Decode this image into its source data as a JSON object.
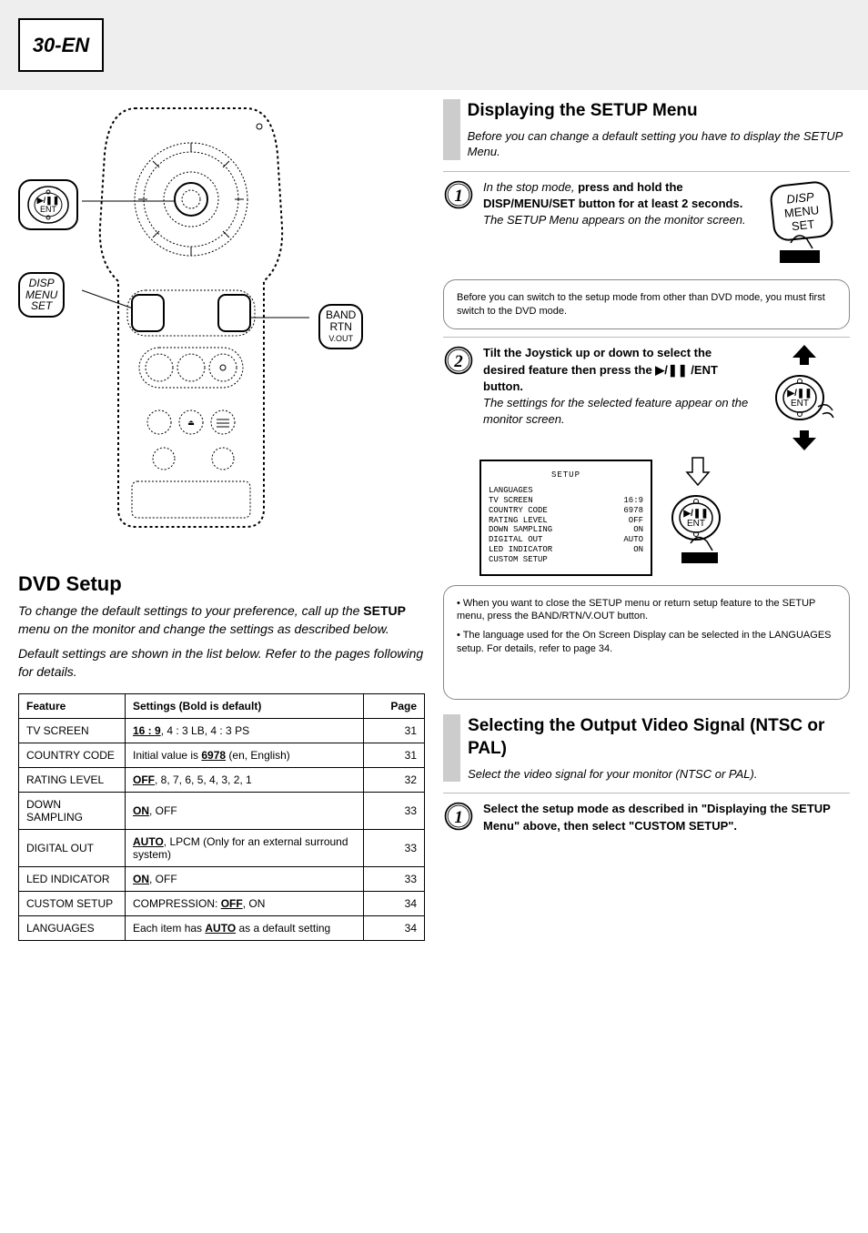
{
  "page_number": "30-EN",
  "callouts": {
    "ent_play_line": "▶/❚❚",
    "ent_label": "ENT",
    "disp": "DISP",
    "menu": "MENU",
    "set": "SET",
    "band": "BAND",
    "rtn": "RTN",
    "vout": "V.OUT"
  },
  "left": {
    "title": "DVD Setup",
    "para1_italic": "To change the default settings to your preference, call up the ",
    "para1_bold": "SETUP",
    "para1_rest": " menu on the monitor and change the settings as described below.",
    "para2": "Default settings are shown in the list below. Refer to the pages following for details.",
    "table": {
      "cols": [
        "Feature",
        "Settings (Bold is default)",
        "Page"
      ],
      "rows": [
        {
          "feature": "TV SCREEN",
          "desc": "<b><u>16 : 9</u></b>, 4 : 3 LB, 4 : 3 PS",
          "page": "31"
        },
        {
          "feature": "COUNTRY CODE",
          "desc": "Initial value is <b><u>6978</u></b> (en, English)",
          "page": "31"
        },
        {
          "feature": "RATING LEVEL",
          "desc": "<b><u>OFF</u></b>, 8, 7, 6, 5, 4, 3, 2, 1",
          "page": "32"
        },
        {
          "feature": "DOWN SAMPLING",
          "desc": "<b><u>ON</u></b>, OFF",
          "page": "33"
        },
        {
          "feature": "DIGITAL OUT",
          "desc": "<b><u>AUTO</u></b>, LPCM (Only for an external surround system)",
          "page": "33"
        },
        {
          "feature": "LED INDICATOR",
          "desc": "<b><u>ON</u></b>, OFF",
          "page": "33"
        },
        {
          "feature": "CUSTOM SETUP",
          "desc": "COMPRESSION: <b><u>OFF</u></b>, ON",
          "page": "34"
        },
        {
          "feature": "LANGUAGES",
          "desc": "Each item has <b><u>AUTO</u></b> as a default setting",
          "page": "34"
        }
      ]
    }
  },
  "right": {
    "sectionA": {
      "heading": "Displaying the SETUP Menu",
      "body": "Before you can change a default setting you have to display the SETUP Menu."
    },
    "step1": {
      "line1_it": "In the stop mode,",
      "line1_bold": " press and hold the DISP/MENU/SET button for at least 2 seconds.",
      "line2": "The SETUP Menu appears on the monitor screen."
    },
    "noteA": "Before you can switch to the setup mode from other than DVD mode, you must first switch to the DVD mode.",
    "step2": {
      "line_bold": "Tilt the Joystick up or down to select the desired feature then press the ▶/❚❚ /ENT button.",
      "line_it": "The settings for the selected feature appear on the monitor screen."
    },
    "setup_screen": {
      "title": "SETUP",
      "rows": [
        [
          "LANGUAGES",
          ""
        ],
        [
          "TV SCREEN",
          "16:9"
        ],
        [
          "COUNTRY CODE",
          "6978"
        ],
        [
          "RATING LEVEL",
          "OFF"
        ],
        [
          "DOWN SAMPLING",
          "ON"
        ],
        [
          "DIGITAL OUT",
          "AUTO"
        ],
        [
          "LED INDICATOR",
          "ON"
        ],
        [
          "CUSTOM SETUP",
          ""
        ]
      ]
    },
    "noteB_lines": [
      "• When you want to close the SETUP menu or return setup feature to the SETUP menu, press the BAND/RTN/V.OUT button.",
      "• The language used for the On Screen Display can be selected in the LANGUAGES setup. For details, refer to page 34."
    ],
    "sectionB": {
      "heading": "Selecting the Output Video Signal (NTSC or PAL)",
      "body": "Select the video signal for your monitor (NTSC or PAL)."
    },
    "step3": {
      "line_bold": "Select the setup mode as described in \"Displaying the SETUP Menu\" above, then select \"CUSTOM SETUP\"."
    }
  }
}
